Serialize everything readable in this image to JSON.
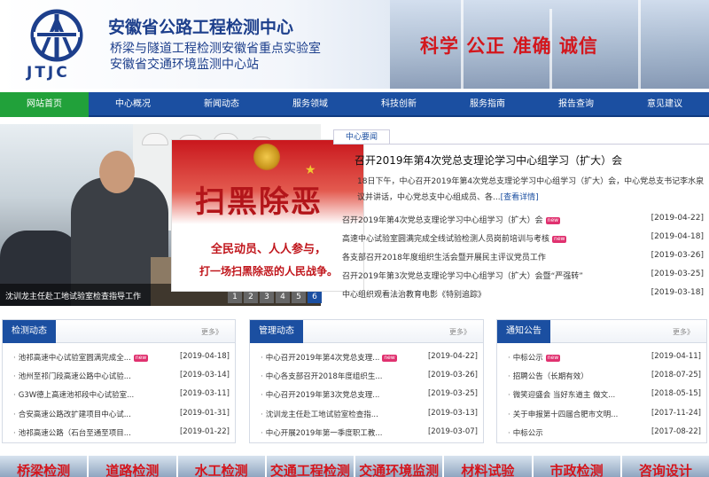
{
  "header": {
    "logo_text": "JTJC",
    "org_name": "安徽省公路工程检测中心",
    "sub1": "桥梁与隧道工程检测安徽省重点实验室",
    "sub2": "安徽省交通环境监测中心站",
    "slogan": "科学  公正  准确  诚信"
  },
  "nav": [
    "网站首页",
    "中心概况",
    "新闻动态",
    "服务领域",
    "科技创新",
    "服务指南",
    "报告查询",
    "意见建议"
  ],
  "slide": {
    "caption": "沈训龙主任赴工地试验室检查指导工作",
    "pages": [
      "1",
      "2",
      "3",
      "4",
      "5",
      "6"
    ],
    "active_page": "6"
  },
  "popup": {
    "title": "扫黑除恶",
    "line1": "全民动员、人人参与，",
    "line2": "打一场扫黑除恶的人民战争。"
  },
  "news": {
    "tab": "中心要闻",
    "headline": "召开2019年第4次党总支理论学习中心组学习（扩大）会",
    "summary1": "18日下午，中心召开2019年第4次党总支理论学习中心组学习（扩大）会，中心党总支书记李水泉",
    "summary2": "议并讲话，中心党总支中心组成员、各...",
    "more": "[查看详情]",
    "items": [
      {
        "title": "召开2019年第4次党总支理论学习中心组学习（扩大）会",
        "new": "new",
        "date": "[2019-04-22]"
      },
      {
        "title": "高速中心试验室圆满完成全线试验检测人员岗前培训与考核",
        "new": "new",
        "date": "[2019-04-18]"
      },
      {
        "title": "各支部召开2018年度组织生活会暨开展民主评议党员工作",
        "new": "",
        "date": "[2019-03-26]"
      },
      {
        "title": "召开2019年第3次党总支理论学习中心组学习（扩大）会暨“严强转”",
        "new": "",
        "date": "[2019-03-25]"
      },
      {
        "title": "中心组织观看法治教育电影《特别追踪》",
        "new": "",
        "date": "[2019-03-18]"
      }
    ]
  },
  "panels": [
    {
      "title": "检测动态",
      "more": "更多》",
      "items": [
        {
          "title": "池祁高速中心试验室圆满完成全...",
          "new": "new",
          "date": "[2019-04-18]"
        },
        {
          "title": "池州至祁门段高速公路中心试验...",
          "new": "",
          "date": "[2019-03-14]"
        },
        {
          "title": "G3W德上高速池祁段中心试验室...",
          "new": "",
          "date": "[2019-03-11]"
        },
        {
          "title": "合安高速公路改扩建项目中心试...",
          "new": "",
          "date": "[2019-01-31]"
        },
        {
          "title": "池祁高速公路（石台至通至项目...",
          "new": "",
          "date": "[2019-01-22]"
        }
      ]
    },
    {
      "title": "管理动态",
      "more": "更多》",
      "items": [
        {
          "title": "中心召开2019年第4次党总支理...",
          "new": "new",
          "date": "[2019-04-22]"
        },
        {
          "title": "中心各支部召开2018年度组织生...",
          "new": "",
          "date": "[2019-03-26]"
        },
        {
          "title": "中心召开2019年第3次党总支理...",
          "new": "",
          "date": "[2019-03-25]"
        },
        {
          "title": "沈训龙主任赴工地试验室检查指...",
          "new": "",
          "date": "[2019-03-13]"
        },
        {
          "title": "中心开展2019年第一季度职工教...",
          "new": "",
          "date": "[2019-03-07]"
        }
      ]
    },
    {
      "title": "通知公告",
      "more": "更多》",
      "items": [
        {
          "title": "中标公示",
          "new": "new",
          "date": "[2019-04-11]"
        },
        {
          "title": "招聘公告（长期有效）",
          "new": "",
          "date": "[2018-07-25]"
        },
        {
          "title": "微笑迎盛会 当好东道主 做文...",
          "new": "",
          "date": "[2018-05-15]"
        },
        {
          "title": "关于申报第十四届合肥市文明...",
          "new": "",
          "date": "[2017-11-24]"
        },
        {
          "title": "中标公示",
          "new": "",
          "date": "[2017-08-22]"
        }
      ]
    }
  ],
  "categories": [
    "桥梁检测",
    "道路检测",
    "水工检测",
    "交通工程检测",
    "交通环境监测",
    "材料试验",
    "市政检测",
    "咨询设计"
  ]
}
